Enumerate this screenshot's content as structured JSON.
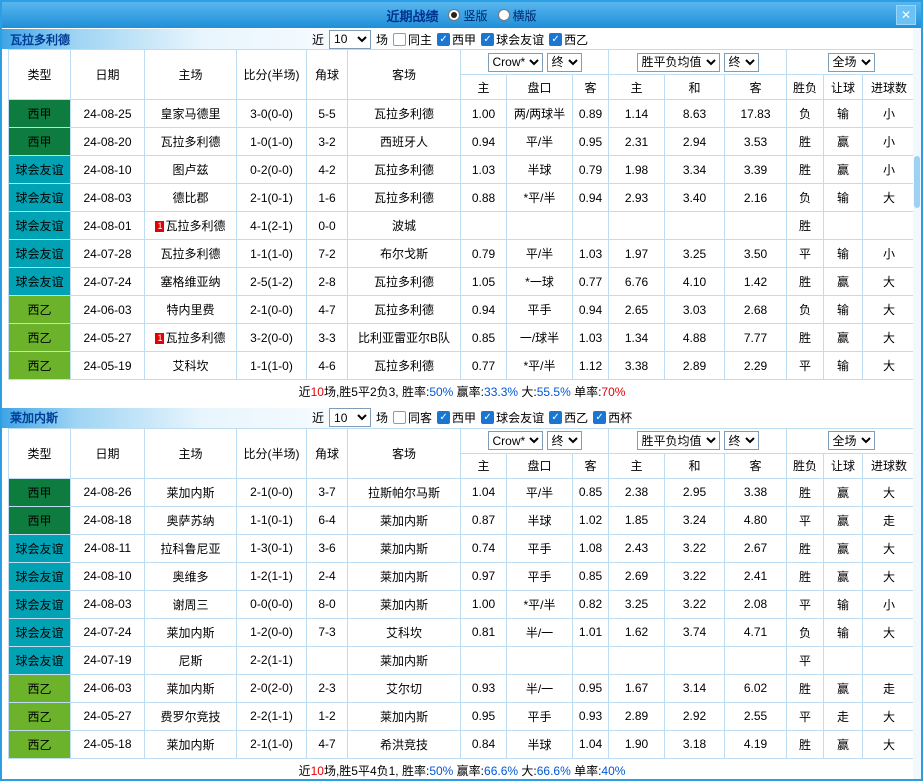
{
  "colors": {
    "accent_blue": "#2b9ee4",
    "title_text": "#00338f",
    "grid_border": "#bedcf2",
    "score_red": "#e60000",
    "self_team_green": "#009933",
    "draw_odds_blue": "#0057d8",
    "league_colors": {
      "西甲": "#0e7c3e",
      "球会友谊": "#00a2b3",
      "西乙": "#6cb32b"
    }
  },
  "titlebar": {
    "title": "近期战绩",
    "radios": [
      {
        "label": "竖版",
        "selected": true
      },
      {
        "label": "横版",
        "selected": false
      }
    ],
    "close_label": "✕"
  },
  "controls": {
    "near": "近",
    "count": "10",
    "games": "场",
    "selects": {
      "bookmaker": "Crow*",
      "final1": "终",
      "avg": "胜平负均值",
      "final2": "终",
      "fulltime": "全场"
    }
  },
  "columns": {
    "left": [
      "类型",
      "日期",
      "主场",
      "比分(半场)",
      "角球",
      "客场"
    ],
    "odds": [
      "主",
      "盘口",
      "客",
      "主",
      "和",
      "客"
    ],
    "right": [
      "胜负",
      "让球",
      "进球数"
    ]
  },
  "sections": [
    {
      "team": "瓦拉多利德",
      "filters": [
        {
          "label": "同主",
          "checked": false
        },
        {
          "label": "西甲",
          "checked": true
        },
        {
          "label": "球会友谊",
          "checked": true
        },
        {
          "label": "西乙",
          "checked": true
        }
      ],
      "rows": [
        {
          "league": "西甲",
          "date": "24-08-25",
          "home": "皇家马德里",
          "home_self": false,
          "home_card": false,
          "score": "3-0(0-0)",
          "corner": "5-5",
          "away": "瓦拉多利德",
          "away_self": true,
          "odds_home": "1.00",
          "handicap": "两/两球半",
          "handicap_red": false,
          "odds_away": "0.89",
          "eu_home": "1.14",
          "eu_draw": "8.63",
          "eu_away": "17.83",
          "result": "负",
          "result_color": "red",
          "let_result": "输",
          "let_color": "green",
          "goal_result": "小",
          "goal_color": "green"
        },
        {
          "league": "西甲",
          "date": "24-08-20",
          "home": "瓦拉多利德",
          "home_self": true,
          "home_card": false,
          "score": "1-0(1-0)",
          "corner": "3-2",
          "away": "西班牙人",
          "away_self": false,
          "odds_home": "0.94",
          "handicap": "平/半",
          "handicap_red": false,
          "odds_away": "0.95",
          "eu_home": "2.31",
          "eu_draw": "2.94",
          "eu_away": "3.53",
          "result": "胜",
          "result_color": "red",
          "let_result": "赢",
          "let_color": "red",
          "goal_result": "小",
          "goal_color": "green"
        },
        {
          "league": "球会友谊",
          "date": "24-08-10",
          "home": "图卢兹",
          "home_self": false,
          "home_card": false,
          "score": "0-2(0-0)",
          "corner": "4-2",
          "away": "瓦拉多利德",
          "away_self": true,
          "odds_home": "1.03",
          "handicap": "半球",
          "handicap_red": false,
          "odds_away": "0.79",
          "eu_home": "1.98",
          "eu_draw": "3.34",
          "eu_away": "3.39",
          "result": "胜",
          "result_color": "red",
          "let_result": "赢",
          "let_color": "red",
          "goal_result": "小",
          "goal_color": "green"
        },
        {
          "league": "球会友谊",
          "date": "24-08-03",
          "home": "德比郡",
          "home_self": false,
          "home_card": false,
          "score": "2-1(0-1)",
          "corner": "1-6",
          "away": "瓦拉多利德",
          "away_self": true,
          "odds_home": "0.88",
          "handicap": "*平/半",
          "handicap_red": true,
          "odds_away": "0.94",
          "eu_home": "2.93",
          "eu_draw": "3.40",
          "eu_away": "2.16",
          "result": "负",
          "result_color": "red",
          "let_result": "输",
          "let_color": "green",
          "goal_result": "大",
          "goal_color": "red"
        },
        {
          "league": "球会友谊",
          "date": "24-08-01",
          "home": "瓦拉多利德",
          "home_self": true,
          "home_card": true,
          "score": "4-1(2-1)",
          "corner": "0-0",
          "away": "波城",
          "away_self": false,
          "odds_home": "",
          "handicap": "",
          "handicap_red": false,
          "odds_away": "",
          "eu_home": "",
          "eu_draw": "",
          "eu_away": "",
          "result": "胜",
          "result_color": "red",
          "let_result": "",
          "let_color": "k",
          "goal_result": "",
          "goal_color": "k"
        },
        {
          "league": "球会友谊",
          "date": "24-07-28",
          "home": "瓦拉多利德",
          "home_self": true,
          "home_card": false,
          "score": "1-1(1-0)",
          "corner": "7-2",
          "away": "布尔戈斯",
          "away_self": false,
          "odds_home": "0.79",
          "handicap": "平/半",
          "handicap_red": false,
          "odds_away": "1.03",
          "eu_home": "1.97",
          "eu_draw": "3.25",
          "eu_away": "3.50",
          "result": "平",
          "result_color": "blue",
          "let_result": "输",
          "let_color": "green",
          "goal_result": "小",
          "goal_color": "green"
        },
        {
          "league": "球会友谊",
          "date": "24-07-24",
          "home": "塞格维亚纳",
          "home_self": false,
          "home_card": false,
          "score": "2-5(1-2)",
          "corner": "2-8",
          "away": "瓦拉多利德",
          "away_self": true,
          "odds_home": "1.05",
          "handicap": "*一球",
          "handicap_red": true,
          "odds_away": "0.77",
          "eu_home": "6.76",
          "eu_draw": "4.10",
          "eu_away": "1.42",
          "result": "胜",
          "result_color": "red",
          "let_result": "赢",
          "let_color": "red",
          "goal_result": "大",
          "goal_color": "red"
        },
        {
          "league": "西乙",
          "date": "24-06-03",
          "home": "特内里费",
          "home_self": false,
          "home_card": false,
          "score": "2-1(0-0)",
          "corner": "4-7",
          "away": "瓦拉多利德",
          "away_self": true,
          "odds_home": "0.94",
          "handicap": "平手",
          "handicap_red": false,
          "odds_away": "0.94",
          "eu_home": "2.65",
          "eu_draw": "3.03",
          "eu_away": "2.68",
          "result": "负",
          "result_color": "red",
          "let_result": "输",
          "let_color": "green",
          "goal_result": "大",
          "goal_color": "red"
        },
        {
          "league": "西乙",
          "date": "24-05-27",
          "home": "瓦拉多利德",
          "home_self": true,
          "home_card": true,
          "score": "3-2(0-0)",
          "corner": "3-3",
          "away": "比利亚雷亚尔B队",
          "away_self": false,
          "odds_home": "0.85",
          "handicap": "一/球半",
          "handicap_red": true,
          "odds_away": "1.03",
          "eu_home": "1.34",
          "eu_draw": "4.88",
          "eu_away": "7.77",
          "result": "胜",
          "result_color": "red",
          "let_result": "赢",
          "let_color": "red",
          "goal_result": "大",
          "goal_color": "red"
        },
        {
          "league": "西乙",
          "date": "24-05-19",
          "home": "艾科坎",
          "home_self": false,
          "home_card": false,
          "score": "1-1(1-0)",
          "corner": "4-6",
          "away": "瓦拉多利德",
          "away_self": true,
          "odds_home": "0.77",
          "handicap": "*平/半",
          "handicap_red": true,
          "odds_away": "1.12",
          "eu_home": "3.38",
          "eu_draw": "2.89",
          "eu_away": "2.29",
          "result": "平",
          "result_color": "blue",
          "let_result": "输",
          "let_color": "green",
          "goal_result": "大",
          "goal_color": "red"
        }
      ],
      "summary": [
        {
          "t": "近",
          "c": "k"
        },
        {
          "t": "10",
          "c": "red"
        },
        {
          "t": "场,胜5平2负3, ",
          "c": "k"
        },
        {
          "t": "胜率:",
          "c": "k"
        },
        {
          "t": "50%",
          "c": "blue"
        },
        {
          "t": " 赢率:",
          "c": "k"
        },
        {
          "t": "33.3%",
          "c": "blue"
        },
        {
          "t": " 大:",
          "c": "k"
        },
        {
          "t": "55.5%",
          "c": "blue"
        },
        {
          "t": " 单率:",
          "c": "k"
        },
        {
          "t": "70%",
          "c": "red"
        }
      ]
    },
    {
      "team": "莱加内斯",
      "filters": [
        {
          "label": "同客",
          "checked": false
        },
        {
          "label": "西甲",
          "checked": true
        },
        {
          "label": "球会友谊",
          "checked": true
        },
        {
          "label": "西乙",
          "checked": true
        },
        {
          "label": "西杯",
          "checked": true
        }
      ],
      "rows": [
        {
          "league": "西甲",
          "date": "24-08-26",
          "home": "莱加内斯",
          "home_self": true,
          "home_card": false,
          "score": "2-1(0-0)",
          "corner": "3-7",
          "away": "拉斯帕尔马斯",
          "away_self": false,
          "odds_home": "1.04",
          "handicap": "平/半",
          "handicap_red": false,
          "odds_away": "0.85",
          "eu_home": "2.38",
          "eu_draw": "2.95",
          "eu_away": "3.38",
          "result": "胜",
          "result_color": "red",
          "let_result": "赢",
          "let_color": "red",
          "goal_result": "大",
          "goal_color": "red"
        },
        {
          "league": "西甲",
          "date": "24-08-18",
          "home": "奥萨苏纳",
          "home_self": false,
          "home_card": false,
          "score": "1-1(0-1)",
          "corner": "6-4",
          "away": "莱加内斯",
          "away_self": true,
          "odds_home": "0.87",
          "handicap": "半球",
          "handicap_red": false,
          "odds_away": "1.02",
          "eu_home": "1.85",
          "eu_draw": "3.24",
          "eu_away": "4.80",
          "result": "平",
          "result_color": "blue",
          "let_result": "赢",
          "let_color": "red",
          "goal_result": "走",
          "goal_color": "blue"
        },
        {
          "league": "球会友谊",
          "date": "24-08-11",
          "home": "拉科鲁尼亚",
          "home_self": false,
          "home_card": false,
          "score": "1-3(0-1)",
          "corner": "3-6",
          "away": "莱加内斯",
          "away_self": true,
          "odds_home": "0.74",
          "handicap": "平手",
          "handicap_red": false,
          "odds_away": "1.08",
          "eu_home": "2.43",
          "eu_draw": "3.22",
          "eu_away": "2.67",
          "result": "胜",
          "result_color": "red",
          "let_result": "赢",
          "let_color": "red",
          "goal_result": "大",
          "goal_color": "red"
        },
        {
          "league": "球会友谊",
          "date": "24-08-10",
          "home": "奥维多",
          "home_self": false,
          "home_card": false,
          "score": "1-2(1-1)",
          "corner": "2-4",
          "away": "莱加内斯",
          "away_self": true,
          "odds_home": "0.97",
          "handicap": "平手",
          "handicap_red": false,
          "odds_away": "0.85",
          "eu_home": "2.69",
          "eu_draw": "3.22",
          "eu_away": "2.41",
          "result": "胜",
          "result_color": "red",
          "let_result": "赢",
          "let_color": "red",
          "goal_result": "大",
          "goal_color": "red"
        },
        {
          "league": "球会友谊",
          "date": "24-08-03",
          "home": "谢周三",
          "home_self": false,
          "home_card": false,
          "score": "0-0(0-0)",
          "corner": "8-0",
          "away": "莱加内斯",
          "away_self": true,
          "odds_home": "1.00",
          "handicap": "*平/半",
          "handicap_red": true,
          "odds_away": "0.82",
          "eu_home": "3.25",
          "eu_draw": "3.22",
          "eu_away": "2.08",
          "result": "平",
          "result_color": "blue",
          "let_result": "输",
          "let_color": "green",
          "goal_result": "小",
          "goal_color": "green"
        },
        {
          "league": "球会友谊",
          "date": "24-07-24",
          "home": "莱加内斯",
          "home_self": true,
          "home_card": false,
          "score": "1-2(0-0)",
          "corner": "7-3",
          "away": "艾科坎",
          "away_self": false,
          "odds_home": "0.81",
          "handicap": "半/一",
          "handicap_red": true,
          "odds_away": "1.01",
          "eu_home": "1.62",
          "eu_draw": "3.74",
          "eu_away": "4.71",
          "result": "负",
          "result_color": "red",
          "let_result": "输",
          "let_color": "green",
          "goal_result": "大",
          "goal_color": "red"
        },
        {
          "league": "球会友谊",
          "date": "24-07-19",
          "home": "尼斯",
          "home_self": false,
          "home_card": false,
          "score": "2-2(1-1)",
          "corner": "",
          "away": "莱加内斯",
          "away_self": true,
          "odds_home": "",
          "handicap": "",
          "handicap_red": false,
          "odds_away": "",
          "eu_home": "",
          "eu_draw": "",
          "eu_away": "",
          "result": "平",
          "result_color": "blue",
          "let_result": "",
          "let_color": "k",
          "goal_result": "",
          "goal_color": "k"
        },
        {
          "league": "西乙",
          "date": "24-06-03",
          "home": "莱加内斯",
          "home_self": true,
          "home_card": false,
          "score": "2-0(2-0)",
          "corner": "2-3",
          "away": "艾尔切",
          "away_self": false,
          "odds_home": "0.93",
          "handicap": "半/一",
          "handicap_red": true,
          "odds_away": "0.95",
          "eu_home": "1.67",
          "eu_draw": "3.14",
          "eu_away": "6.02",
          "result": "胜",
          "result_color": "red",
          "let_result": "赢",
          "let_color": "red",
          "goal_result": "走",
          "goal_color": "blue"
        },
        {
          "league": "西乙",
          "date": "24-05-27",
          "home": "费罗尔竞技",
          "home_self": false,
          "home_card": false,
          "score": "2-2(1-1)",
          "corner": "1-2",
          "away": "莱加内斯",
          "away_self": true,
          "odds_home": "0.95",
          "handicap": "平手",
          "handicap_red": false,
          "odds_away": "0.93",
          "eu_home": "2.89",
          "eu_draw": "2.92",
          "eu_away": "2.55",
          "result": "平",
          "result_color": "blue",
          "let_result": "走",
          "let_color": "blue",
          "goal_result": "大",
          "goal_color": "red"
        },
        {
          "league": "西乙",
          "date": "24-05-18",
          "home": "莱加内斯",
          "home_self": true,
          "home_card": false,
          "score": "2-1(1-0)",
          "corner": "4-7",
          "away": "希洪竞技",
          "away_self": false,
          "odds_home": "0.84",
          "handicap": "半球",
          "handicap_red": false,
          "odds_away": "1.04",
          "eu_home": "1.90",
          "eu_draw": "3.18",
          "eu_away": "4.19",
          "result": "胜",
          "result_color": "red",
          "let_result": "赢",
          "let_color": "red",
          "goal_result": "大",
          "goal_color": "red"
        }
      ],
      "summary": [
        {
          "t": "近",
          "c": "k"
        },
        {
          "t": "10",
          "c": "red"
        },
        {
          "t": "场,胜5平4负1, ",
          "c": "k"
        },
        {
          "t": "胜率:",
          "c": "k"
        },
        {
          "t": "50%",
          "c": "blue"
        },
        {
          "t": " 赢率:",
          "c": "k"
        },
        {
          "t": "66.6%",
          "c": "blue"
        },
        {
          "t": " 大:",
          "c": "k"
        },
        {
          "t": "66.6%",
          "c": "blue"
        },
        {
          "t": " 单率:",
          "c": "k"
        },
        {
          "t": "40%",
          "c": "blue"
        }
      ]
    }
  ]
}
